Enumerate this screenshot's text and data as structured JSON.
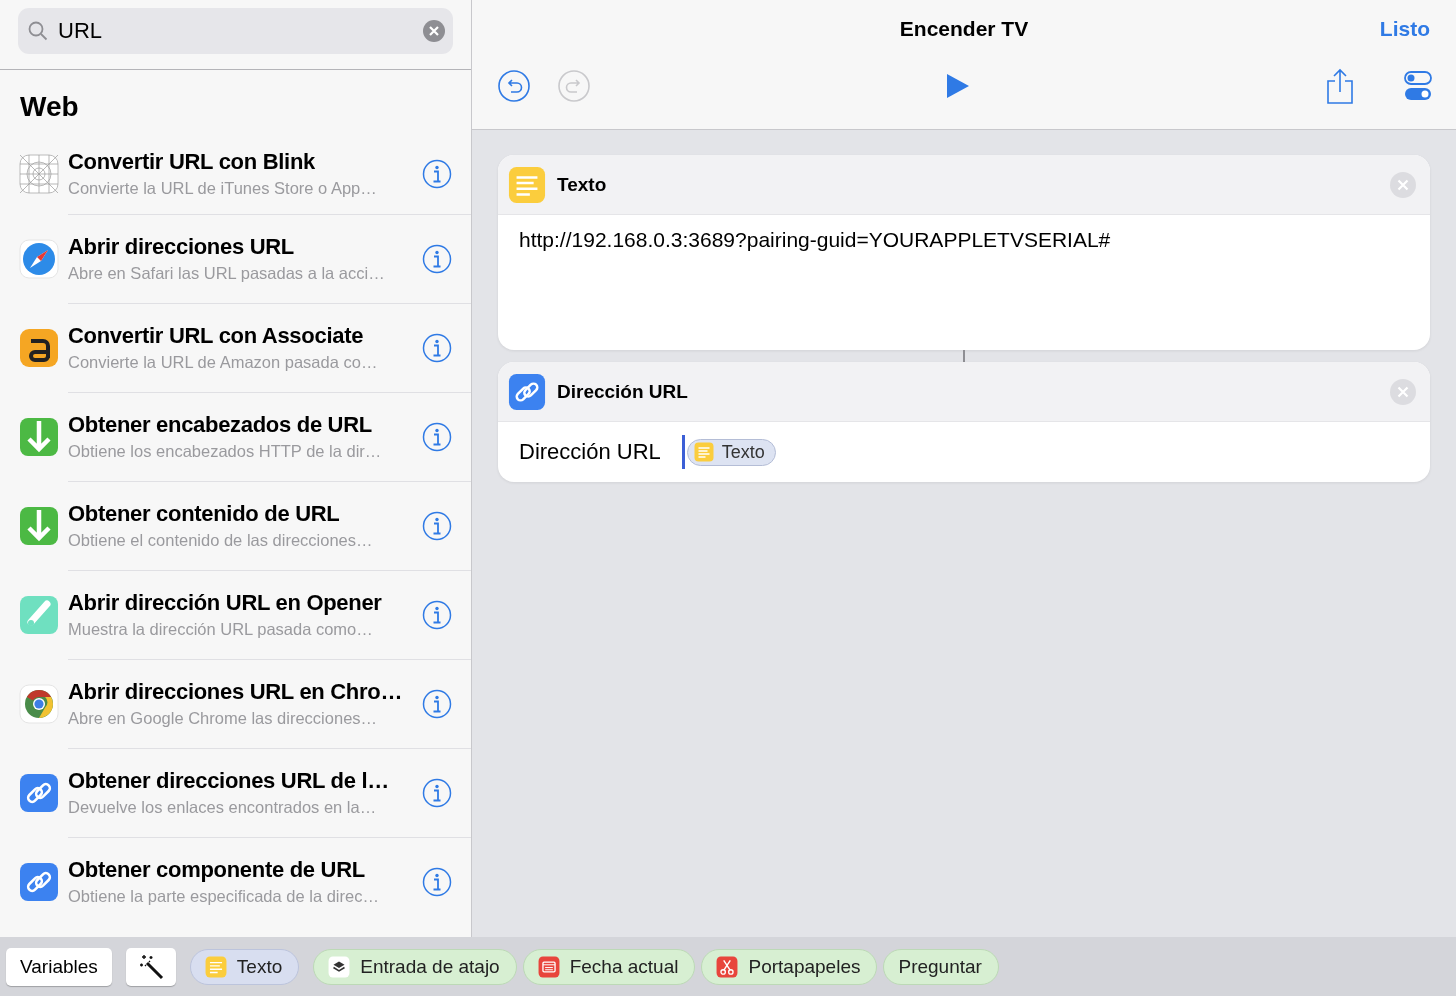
{
  "search": {
    "value": "URL"
  },
  "section_title": "Web",
  "actions": [
    {
      "kind": "grid",
      "title": "Convertir URL con Blink",
      "subtitle": "Convierte la URL de iTunes Store o App…"
    },
    {
      "kind": "compass",
      "title": "Abrir direcciones URL",
      "subtitle": "Abre en Safari las URL pasadas a la acci…"
    },
    {
      "kind": "letter",
      "title": "Convertir URL con Associate",
      "subtitle": "Convierte la URL de Amazon pasada co…"
    },
    {
      "kind": "download",
      "title": "Obtener encabezados de URL",
      "subtitle": "Obtiene los encabezados HTTP de la dir…"
    },
    {
      "kind": "download",
      "title": "Obtener contenido de URL",
      "subtitle": "Obtiene el contenido de las direcciones…"
    },
    {
      "kind": "pin",
      "title": "Abrir dirección URL en Opener",
      "subtitle": "Muestra la dirección URL pasada como…"
    },
    {
      "kind": "wheel",
      "title": "Abrir direcciones URL en Chro…",
      "subtitle": "Abre en Google Chrome las direcciones…"
    },
    {
      "kind": "link",
      "title": "Obtener direcciones URL de l…",
      "subtitle": "Devuelve los enlaces encontrados en la…"
    },
    {
      "kind": "link",
      "title": "Obtener componente de URL",
      "subtitle": "Obtiene la parte especificada de la direc…"
    }
  ],
  "header": {
    "title": "Encender TV",
    "done": "Listo",
    "redo_disabled": true
  },
  "cards": [
    {
      "kind": "text",
      "title": "Texto",
      "content": "http://192.168.0.3:3689?pairing-guid=YOURAPPLETVSERIAL#"
    },
    {
      "kind": "param",
      "title": "Dirección URL",
      "label": "Dirección URL",
      "token": "Texto"
    }
  ],
  "bottom_bar": {
    "variables": "Variables",
    "chips": [
      {
        "kind": "text",
        "label": "Texto"
      },
      {
        "kind": "input",
        "label": "Entrada de atajo"
      },
      {
        "kind": "date",
        "label": "Fecha actual"
      },
      {
        "kind": "clipboard",
        "label": "Portapapeles"
      },
      {
        "kind": "ask",
        "label": "Preguntar"
      }
    ]
  }
}
